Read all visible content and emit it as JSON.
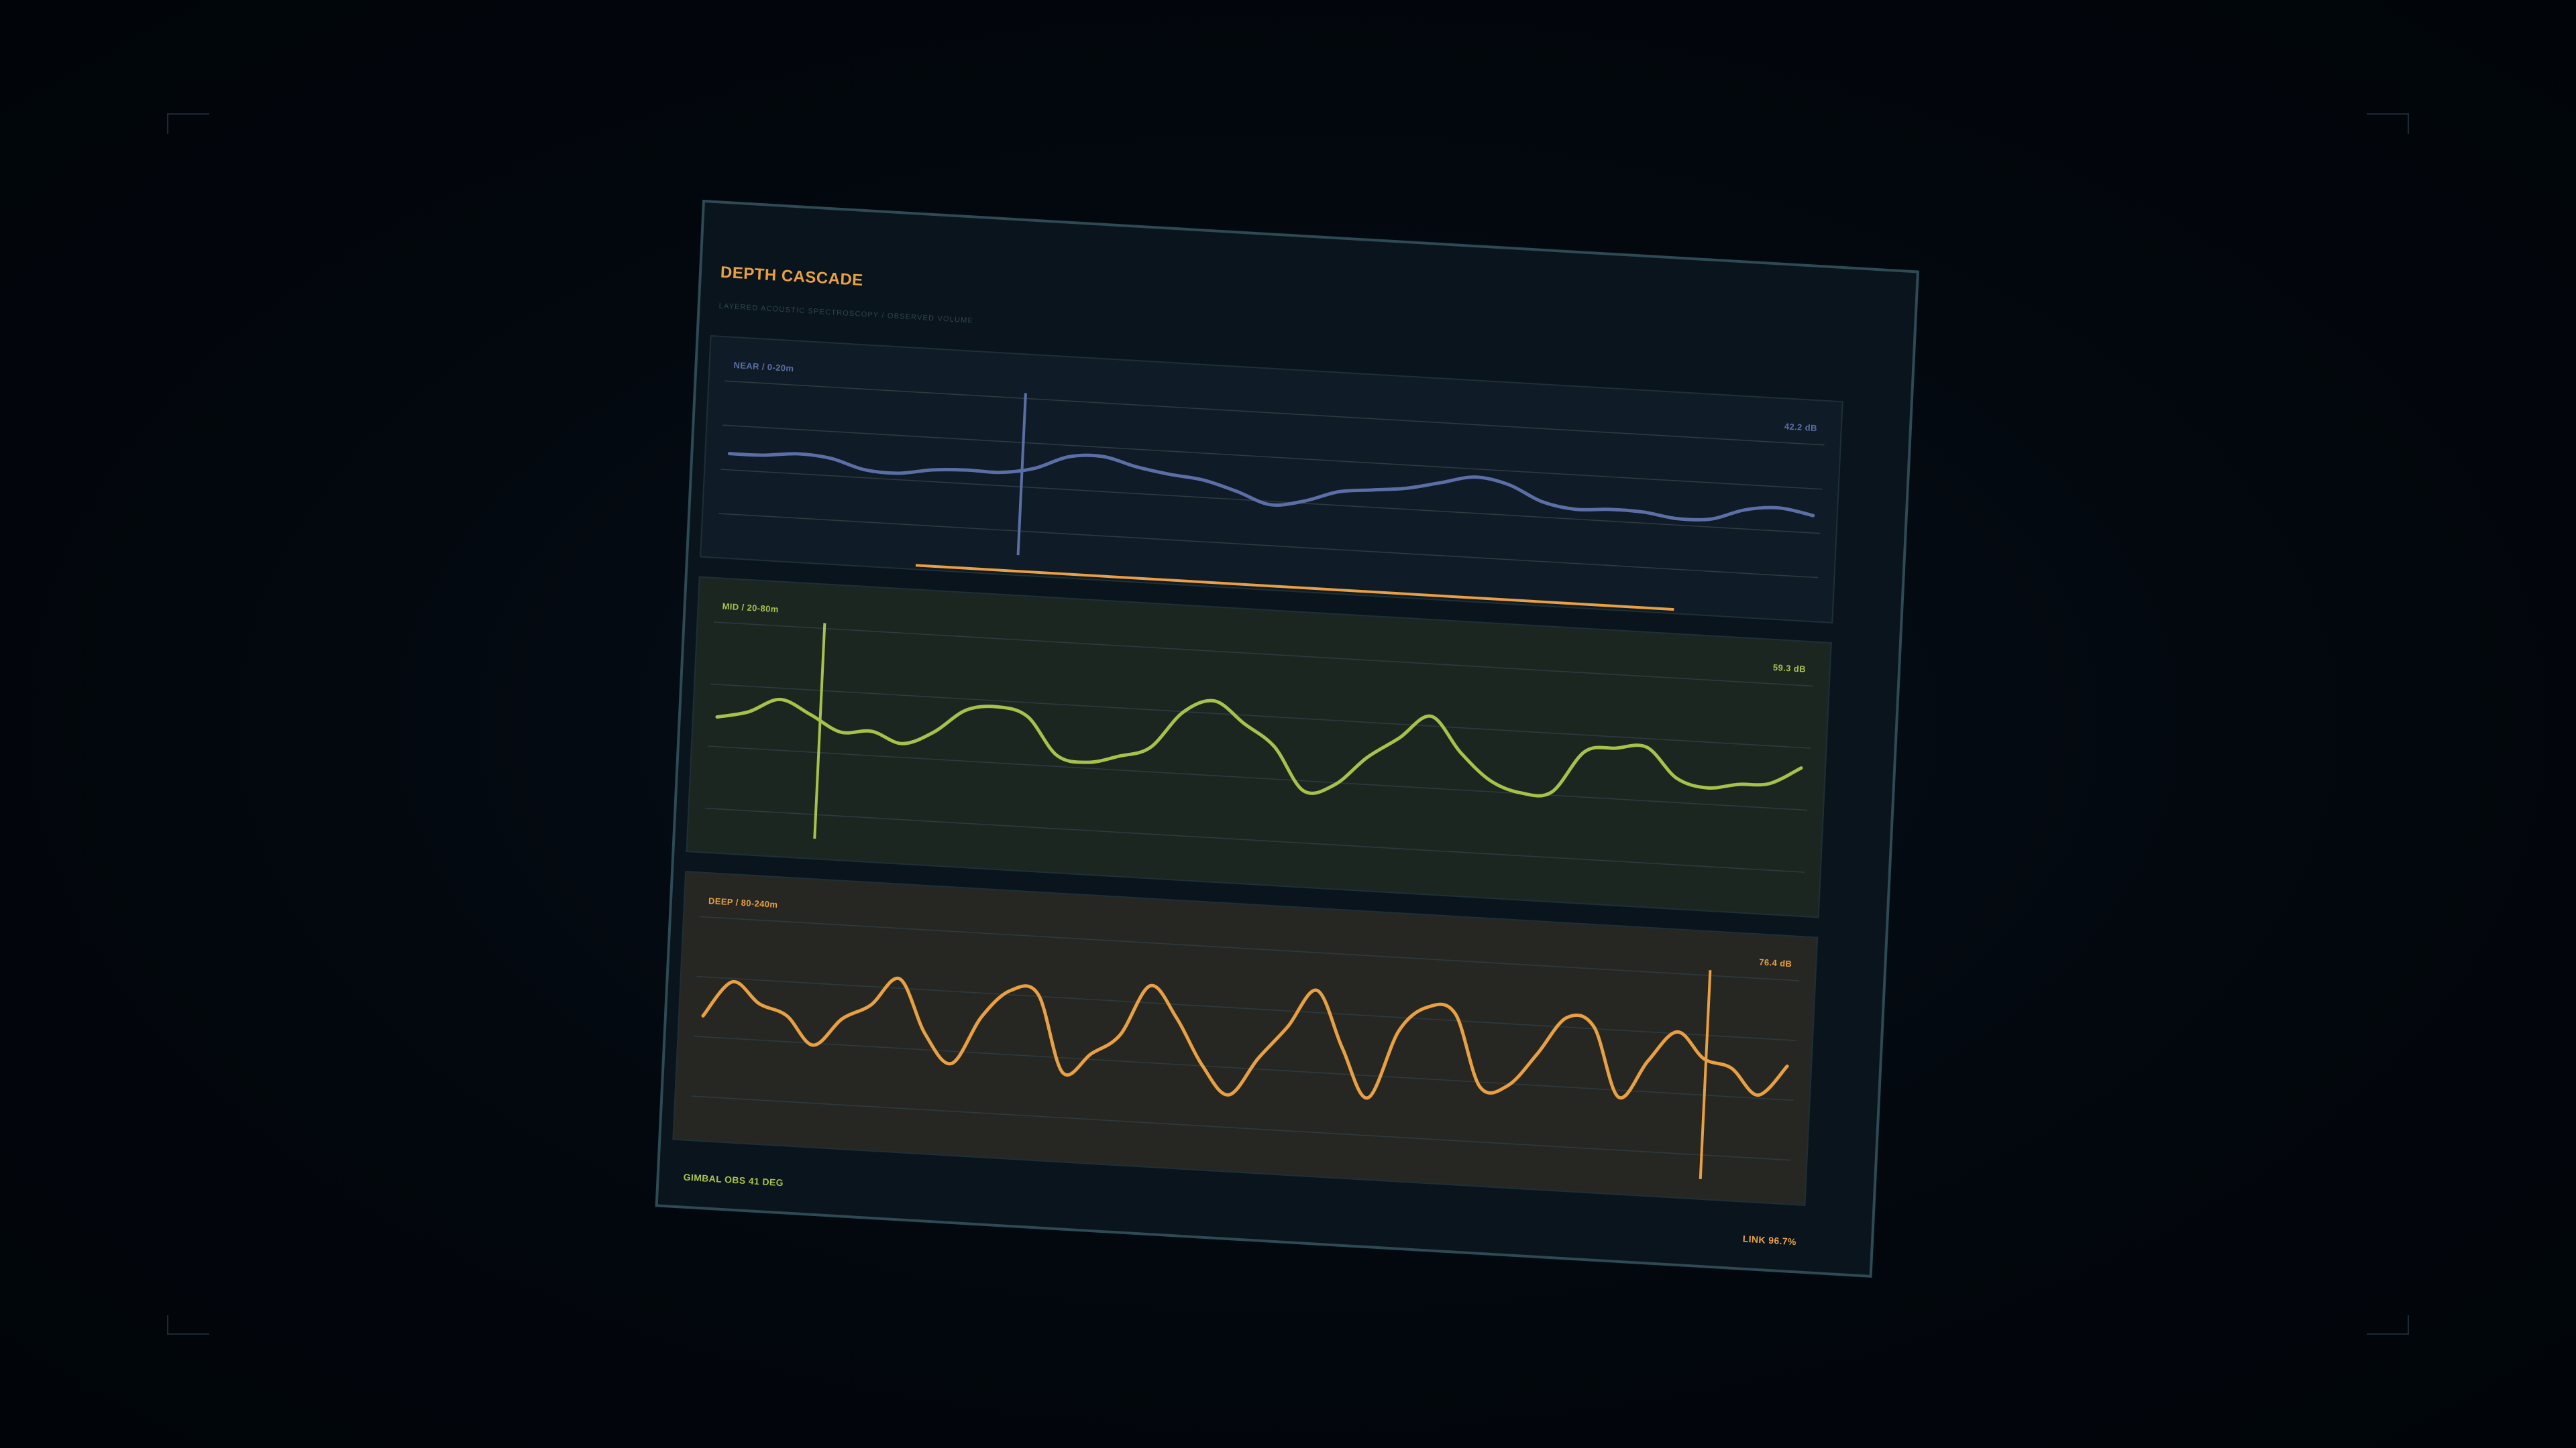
{
  "header": {
    "title": "DEPTH CASCADE",
    "subtitle": "LAYERED ACOUSTIC SPECTROSCOPY / OBSERVED VOLUME"
  },
  "bands": [
    {
      "id": "near",
      "label": "NEAR / 0-20m",
      "value": "42.2 dB",
      "color": "#5b6fa6",
      "bg": "#0f1b27",
      "cursor_fraction": 0.27,
      "scrubber": [
        0.19,
        0.86
      ],
      "wave": [
        0.02,
        0.03,
        0.12,
        0.05,
        -0.2,
        -0.24,
        -0.1,
        -0.05,
        -0.06,
        0.1,
        0.46,
        0.52,
        0.3,
        0.15,
        0.05,
        -0.2,
        -0.5,
        -0.35,
        -0.05,
        0.05,
        0.15,
        0.35,
        0.55,
        0.4,
        0.0,
        -0.15,
        -0.1,
        -0.12,
        -0.24,
        -0.2,
        0.1,
        0.2,
        0.05
      ]
    },
    {
      "id": "mid",
      "label": "MID / 20-80m",
      "value": "59.3 dB",
      "color": "#a7c24a",
      "bg": "#1b2621",
      "cursor_fraction": 0.095,
      "wave": [
        0.15,
        0.28,
        0.55,
        0.3,
        0.0,
        0.05,
        -0.15,
        0.1,
        0.55,
        0.65,
        0.5,
        -0.2,
        -0.3,
        -0.15,
        0.05,
        0.75,
        1.0,
        0.6,
        0.2,
        -0.6,
        -0.45,
        0.1,
        0.5,
        0.95,
        0.3,
        -0.2,
        -0.4,
        -0.35,
        0.45,
        0.55,
        0.6,
        0.05,
        -0.1,
        0.0,
        0.05,
        0.38
      ]
    },
    {
      "id": "deep",
      "label": "DEEP / 80-240m",
      "value": "76.4 dB",
      "color": "#e8a043",
      "bg": "#262722",
      "cursor_fraction": 0.925,
      "wave": [
        0.0,
        0.7,
        0.3,
        0.1,
        -0.45,
        0.1,
        0.4,
        0.95,
        -0.1,
        -0.65,
        0.3,
        0.85,
        0.8,
        -0.7,
        -0.3,
        0.1,
        1.1,
        0.5,
        -0.4,
        -0.95,
        -0.2,
        0.45,
        1.2,
        0.1,
        -0.85,
        0.5,
        1.0,
        0.9,
        -0.5,
        -0.45,
        0.2,
        0.95,
        0.8,
        -0.55,
        0.2,
        0.8,
        0.3,
        0.15,
        -0.35,
        0.25
      ]
    }
  ],
  "footer": {
    "gimbal": "GIMBAL OBS  41 DEG",
    "link": "LINK 96.7%",
    "gimbal_color": "#a7c24a",
    "link_color": "#e8a043"
  },
  "colors": {
    "title": "#e8a043",
    "subtitle": "#2d4650",
    "panel_bg": "#0a141c",
    "panel_border": "#2e4a55",
    "grid": "#2d3a3e"
  }
}
